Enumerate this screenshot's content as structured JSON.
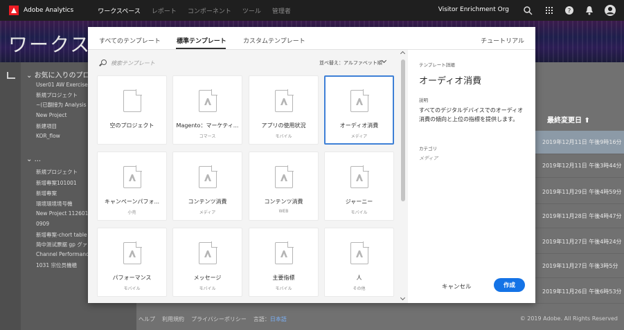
{
  "topnav": {
    "app_name": "Adobe Analytics",
    "links": [
      "ワークスペース",
      "レポート",
      "コンポーネント",
      "ツール",
      "管理者"
    ],
    "org": "Visitor Enrichment Org"
  },
  "banner": {
    "title": "ワークス"
  },
  "left": {
    "favorites_title": "お気に入りのプロ",
    "favorites": [
      "User01 AW Exercises",
      "新規プロジェクト",
      "~(已翻接为 Analysis W",
      "New Project",
      "新建項目",
      "KOR_flow"
    ],
    "more_title": "...",
    "projects": [
      "新規プロジェクト",
      "新增專案101001",
      "新增專案",
      "環境環境境号機",
      "New Project 112601",
      "0909",
      "新增專案-chort table",
      "简中测试票据 gp グァ",
      "Channel Performance",
      "1031 宗位员機穂"
    ]
  },
  "table": {
    "column_header": "最終変更日 ⬆",
    "dates": [
      "2019年12月11日 午後9時16分",
      "2019年12月11日 午後3時44分",
      "2019年11月29日 午後4時59分",
      "2019年11月28日 午後4時47分",
      "2019年11月27日 午後4時24分",
      "2019年11月27日 午後3時5分",
      "2019年11月26日 午後6時53分"
    ]
  },
  "footer": {
    "links": [
      "ヘルプ",
      "利用規約",
      "プライバシーポリシー",
      "言語："
    ],
    "language": "日本語",
    "copyright": "© 2019 Adobe. All Rights Reserved"
  },
  "modal": {
    "tabs": [
      "すべてのテンプレート",
      "標準テンプレート",
      "カスタムテンプレート"
    ],
    "active_tab": "標準テンプレート",
    "tutorial": "チュートリアル",
    "search_placeholder": "検索テンプレート",
    "sort_label": "並べ替え：アルファベット順",
    "templates": [
      {
        "name": "空のプロジェクト",
        "category": ""
      },
      {
        "name": "Magento：マーケティ...",
        "category": "コマース"
      },
      {
        "name": "アプリの使用状況",
        "category": "モバイル"
      },
      {
        "name": "オーディオ消費",
        "category": "メディア"
      },
      {
        "name": "キャンペーンパフォ...",
        "category": "小売"
      },
      {
        "name": "コンテンツ消費",
        "category": "メディア"
      },
      {
        "name": "コンテンツ消費",
        "category": "WEB"
      },
      {
        "name": "ジャーニー",
        "category": "モバイル"
      },
      {
        "name": "パフォーマンス",
        "category": "モバイル"
      },
      {
        "name": "メッセージ",
        "category": "モバイル"
      },
      {
        "name": "主要指標",
        "category": "モバイル"
      },
      {
        "name": "人",
        "category": "その他"
      }
    ],
    "details": {
      "section_label": "テンプレート詳細",
      "title": "オーディオ消費",
      "desc_label": "説明",
      "description": "すべてのデジタルデバイスでのオーディオ消費の傾向と上位の指標を提供します。",
      "category_label": "カテゴリ",
      "category": "メディア"
    },
    "cancel_label": "キャンセル",
    "create_label": "作成"
  }
}
